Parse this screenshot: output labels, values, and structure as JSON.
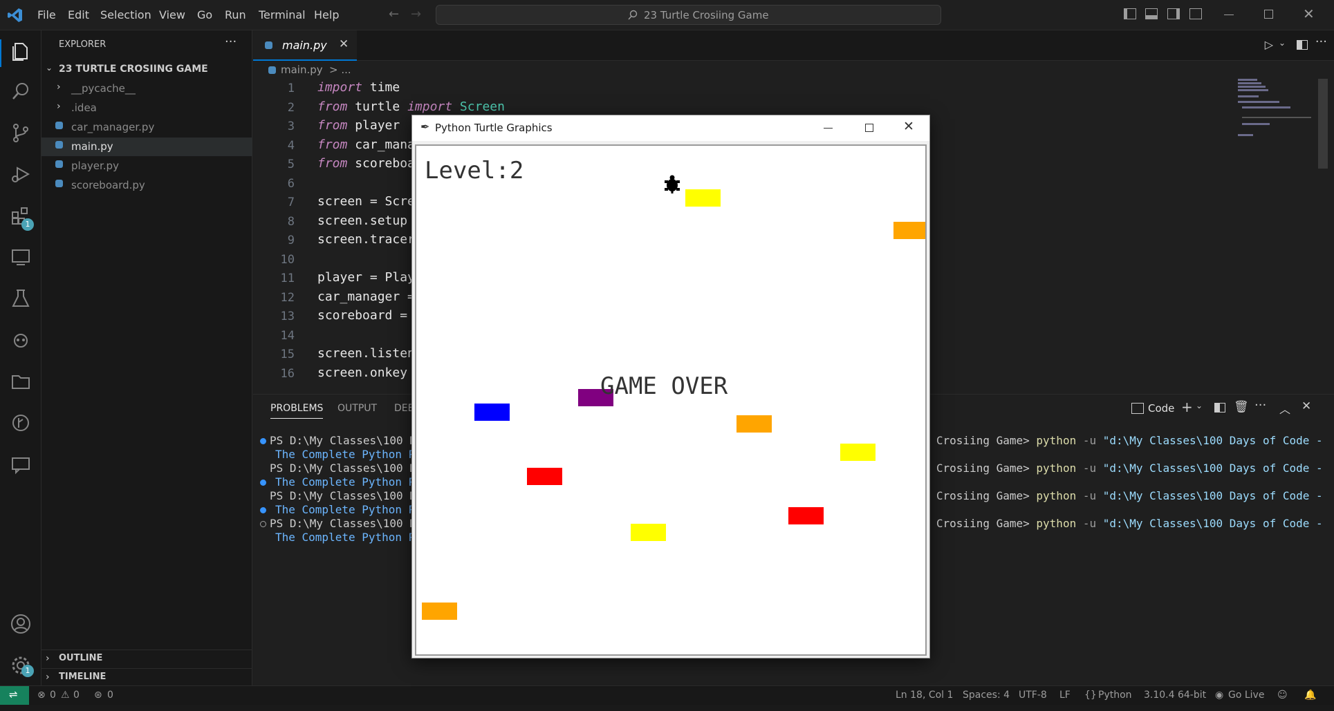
{
  "window": {
    "title": "23 Turtle Crosiing Game"
  },
  "menu": [
    "File",
    "Edit",
    "Selection",
    "View",
    "Go",
    "Run",
    "Terminal",
    "Help"
  ],
  "sidebar": {
    "header": "EXPLORER",
    "folder": "23 TURTLE CROSIING GAME",
    "items": [
      "__pycache__",
      ".idea",
      "car_manager.py",
      "main.py",
      "player.py",
      "scoreboard.py"
    ],
    "outline": "OUTLINE",
    "timeline": "TIMELINE"
  },
  "activity_badges": {
    "extensions": "1",
    "settings": "1"
  },
  "editor": {
    "tab": "main.py",
    "breadcrumb_file": "main.py",
    "breadcrumb_sep": "> ...",
    "line_numbers": [
      "1",
      "2",
      "3",
      "4",
      "5",
      "6",
      "7",
      "8",
      "9",
      "10",
      "11",
      "12",
      "13",
      "14",
      "15",
      "16"
    ],
    "lines": [
      [
        "import",
        " time"
      ],
      [
        "from",
        " turtle ",
        "import",
        " Screen"
      ],
      [
        "from",
        " player "
      ],
      [
        "from",
        " car_mana"
      ],
      [
        "from",
        " scoreboa"
      ],
      [
        ""
      ],
      [
        "screen = Scre"
      ],
      [
        "screen.setup"
      ],
      [
        "screen.tracer"
      ],
      [
        ""
      ],
      [
        "player = Play"
      ],
      [
        "car_manager ="
      ],
      [
        "scoreboard ="
      ],
      [
        ""
      ],
      [
        "screen.listen"
      ],
      [
        "screen.onkey"
      ]
    ]
  },
  "panel": {
    "tabs": [
      "PROBLEMS",
      "OUTPUT",
      "DEB"
    ],
    "terminal_label": "Code",
    "terminal_lines": [
      {
        "prompt": "PS D:\\My Classes\\100 Da",
        "rest_prefix": "le Crosiing Game>",
        "cmd": "python",
        "args": "-u",
        "path": "\"d:\\My Classes\\100 Days of Code -"
      },
      {
        "prompt": "PS D:\\My Classes\\100 Da",
        "rest_prefix": "le Crosiing Game>",
        "cmd": "python",
        "args": "-u",
        "path": "\"d:\\My Classes\\100 Days of Code -"
      },
      {
        "prompt": "PS D:\\My Classes\\100 Da",
        "rest_prefix": "le Crosiing Game>",
        "cmd": "python",
        "args": "-u",
        "path": "\"d:\\My Classes\\100 Days of Code -"
      },
      {
        "prompt": "PS D:\\My Classes\\100 Da",
        "rest_prefix": "le Crosiing Game>",
        "cmd": "python",
        "args": "-u",
        "path": "\"d:\\My Classes\\100 Days of Code -"
      }
    ],
    "continuation": "The Complete Python Pr"
  },
  "turtle": {
    "title": "Python Turtle Graphics",
    "level": "Level:2",
    "game_over": "GAME OVER",
    "car_colors": {
      "yellow": "#ffff00",
      "orange": "#ffa500",
      "purple": "#800080",
      "blue": "#0000ff",
      "red": "#ff0000"
    }
  },
  "status": {
    "errors": "0",
    "warnings": "0",
    "ports": "0",
    "position": "Ln 18, Col 1",
    "spaces": "Spaces: 4",
    "encoding": "UTF-8",
    "eol": "LF",
    "language": "Python",
    "interpreter": "3.10.4 64-bit",
    "golive": "Go Live"
  }
}
